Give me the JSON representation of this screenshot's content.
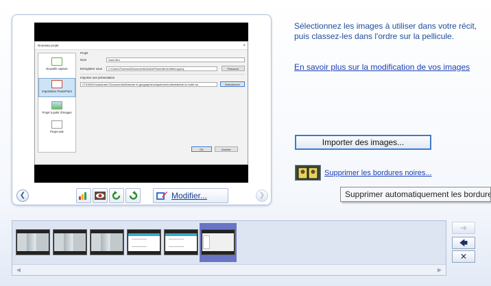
{
  "instructions": {
    "text": "Sélectionnez les images à utiliser dans votre récit, puis classez-les dans l'ordre sur la pellicule.",
    "learn_more_link": "En savoir plus sur la modification de vos images"
  },
  "actions": {
    "import_button": "Importer des images...",
    "remove_borders_link": "Supprimer les bordures noires...",
    "tooltip": "Supprimer automatiquement les bordures"
  },
  "toolbar": {
    "modify_label": "Modifier...",
    "prev_icon": "circle-left-arrow",
    "next_icon": "circle-right-arrow"
  },
  "preview_dialog": {
    "title": "Nouveau projet",
    "close_glyph": "×",
    "options": [
      {
        "label": "Nouvelle capture",
        "selected": false
      },
      {
        "label": "Importation PowerPoint",
        "selected": true
      },
      {
        "label": "Projet à partir d'images",
        "selected": false
      },
      {
        "label": "Projet vide",
        "selected": false
      }
    ],
    "section_project": "Projet",
    "name_label": "Nom",
    "name_value": "Sans titre",
    "save_label": "Enregistrer sous",
    "save_value": "C:\\Users\\Ticemani\\Documents\\ActivePresenter\\Untitled.approj",
    "browse_button": "Parcourir",
    "import_section": "Importer une présentation",
    "import_value": "\\\\TICEBOX\\usbshare7\\Documents3\\histoire et géographie\\cinquième\\multimédia\\de la motte au",
    "select_button": "Sélectionner",
    "ok_button": "OK",
    "cancel_button": "Annuler"
  },
  "filmstrip": {
    "thumbnails": [
      {
        "kind": "gray"
      },
      {
        "kind": "gray"
      },
      {
        "kind": "gray"
      },
      {
        "kind": "web"
      },
      {
        "kind": "web"
      },
      {
        "kind": "dialog",
        "selected": true
      }
    ],
    "selected_index": 5
  },
  "side_buttons": {
    "move_right": "➔",
    "move_left": "🡄",
    "remove": "✕"
  }
}
